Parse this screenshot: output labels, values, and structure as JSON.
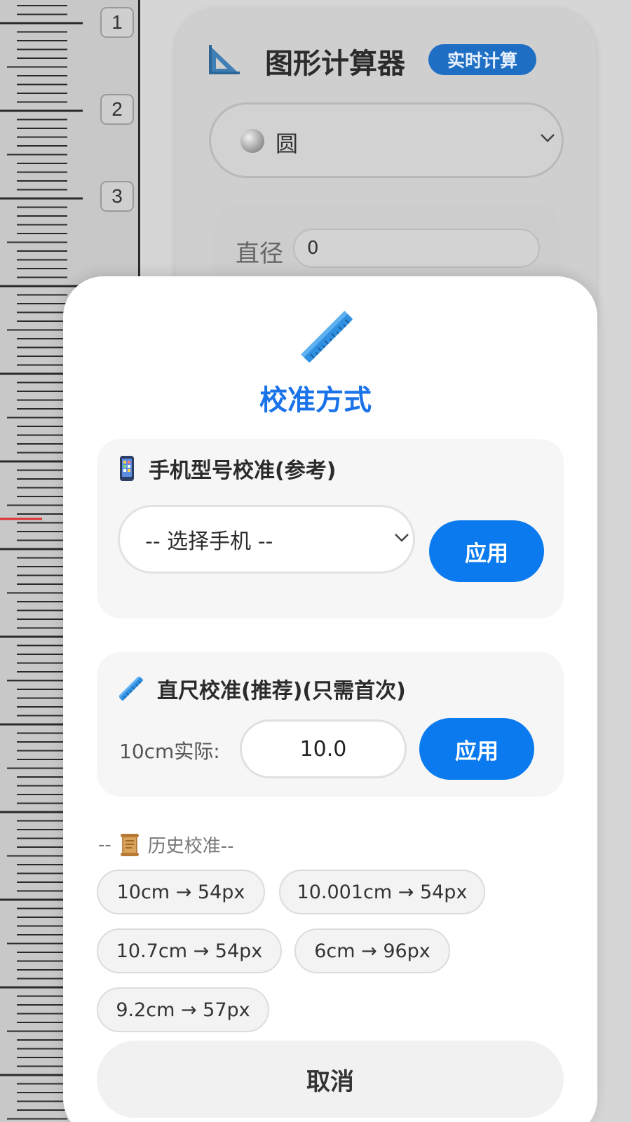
{
  "ruler": {
    "labels": [
      "1",
      "2",
      "3"
    ]
  },
  "calculator": {
    "title": "图形计算器",
    "badge": "实时计算",
    "shape_select": {
      "value": "圆"
    },
    "dimension": {
      "label": "直径",
      "value": "0"
    }
  },
  "modal": {
    "title": "校准方式",
    "phone_section": {
      "title": "手机型号校准(参考)",
      "select_value": "-- 选择手机 --",
      "apply_label": "应用"
    },
    "ruler_section": {
      "title": "直尺校准(推荐)(只需首次)",
      "input_label": "10cm实际:",
      "input_value": "10.0",
      "apply_label": "应用"
    },
    "history": {
      "prefix": "--",
      "title": "历史校准--",
      "chips": [
        "10cm → 54px",
        "10.001cm → 54px",
        "10.7cm → 54px",
        "6cm → 96px",
        "9.2cm → 57px"
      ]
    },
    "cancel_label": "取消"
  },
  "colors": {
    "accent": "#1a73e8",
    "button": "#0a7aee",
    "badge": "#1e6fc4"
  }
}
